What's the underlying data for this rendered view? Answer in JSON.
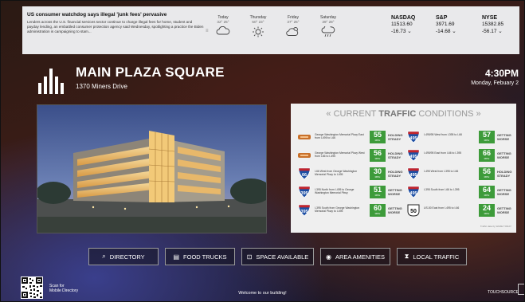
{
  "news": {
    "title": "US consumer watchdog says illegal 'junk fees' pervasive",
    "body": "Lenders across the U.S. financial services sector continue to charge illegal fees for home, student and payday lending, an embattled consumer protection agency said Wednesday, spotlighting a practice the Biden administration is campaigning to stam..."
  },
  "weather": [
    {
      "day": "Today",
      "temp": "32° 25°",
      "icon": "cloud-icon"
    },
    {
      "day": "Thursday",
      "temp": "50° 23°",
      "icon": "sun-icon"
    },
    {
      "day": "Friday",
      "temp": "37° 25°",
      "icon": "partly-cloudy-icon"
    },
    {
      "day": "Saturday",
      "temp": "39° 28°",
      "icon": "rain-icon"
    }
  ],
  "stocks": [
    {
      "symbol": "NASDAQ",
      "value": "11513.60",
      "change": "-16.73"
    },
    {
      "symbol": "S&P",
      "value": "3971.69",
      "change": "-14.68"
    },
    {
      "symbol": "NYSE",
      "value": "15382.85",
      "change": "-56.17"
    }
  ],
  "building": {
    "name": "MAIN PLAZA SQUARE",
    "address": "1370 Miners Drive"
  },
  "clock": {
    "time": "4:30PM",
    "date": "Monday, Febuary 2"
  },
  "traffic": {
    "title_prefix": "CURRENT",
    "title_bold": "TRAFFIC",
    "title_suffix": "CONDITIONS",
    "unit": "MPH",
    "rows_left": [
      {
        "shield": "toll-icon",
        "desc": "George Washington Memorial Pkwy East from I-495 to I-66",
        "speed": "55",
        "status": "HOLDING\nSTEADY"
      },
      {
        "shield": "toll-icon",
        "desc": "George Washington Memorial Pkwy West from I-66 to I-495",
        "speed": "56",
        "status": "HOLDING\nSTEADY"
      },
      {
        "shield": "interstate-66-icon",
        "desc": "I-66 West from George Washington Memorial Pkwy to I-495",
        "speed": "30",
        "status": "HOLDING\nSTEADY"
      },
      {
        "shield": "interstate-395-icon",
        "desc": "I-395 North from I-495 to George Washington Memorial Pkwy",
        "speed": "51",
        "status": "GETTING\nWORSE"
      },
      {
        "shield": "interstate-395-icon",
        "desc": "I-395 South from George Washington Memorial Pkwy to I-495",
        "speed": "60",
        "status": "GETTING\nWORSE"
      }
    ],
    "rows_right": [
      {
        "shield": "interstate-495-icon",
        "desc": "I-495/95 West from I-395 to I-66",
        "speed": "57",
        "status": "GETTING\nWORSE"
      },
      {
        "shield": "interstate-495-icon",
        "desc": "I-495/95 East from I-66 to I-395",
        "speed": "66",
        "status": "GETTING\nWORSE"
      },
      {
        "shield": "interstate-495-icon",
        "desc": "I-495 West from I-395 to I-66",
        "speed": "56",
        "status": "HOLDING\nSTEADY"
      },
      {
        "shield": "interstate-495-icon",
        "desc": "I-395 South from I-66 to I-395",
        "speed": "64",
        "status": "GETTING\nWORSE"
      },
      {
        "shield": "us-50-icon",
        "desc": "US-50 East from I-495 to I-66",
        "speed": "24",
        "status": "GETTING\nWORSE"
      }
    ],
    "footer": "Traffic data by WAZE TODAY"
  },
  "shields": {
    "66": "66",
    "395": "395",
    "495": "495",
    "50": "50"
  },
  "nav": [
    {
      "label": "DIRECTORY",
      "icon": "search-icon"
    },
    {
      "label": "FOOD TRUCKS",
      "icon": "document-icon"
    },
    {
      "label": "SPACE AVAILABLE",
      "icon": "floorplan-icon"
    },
    {
      "label": "AREA AMENITIES",
      "icon": "amenities-icon"
    },
    {
      "label": "LOCAL TRAFFIC",
      "icon": "traffic-light-icon"
    }
  ],
  "footer": {
    "qr_line1": "Scan for",
    "qr_line2": "Mobile Directory",
    "welcome": "Welcome to our building!",
    "brand": "TOUCHSOURCE"
  },
  "colors": {
    "speed_green": "#3d9b3a",
    "panel_bg": "#efefef",
    "topbar_bg": "#e9e9eb"
  }
}
